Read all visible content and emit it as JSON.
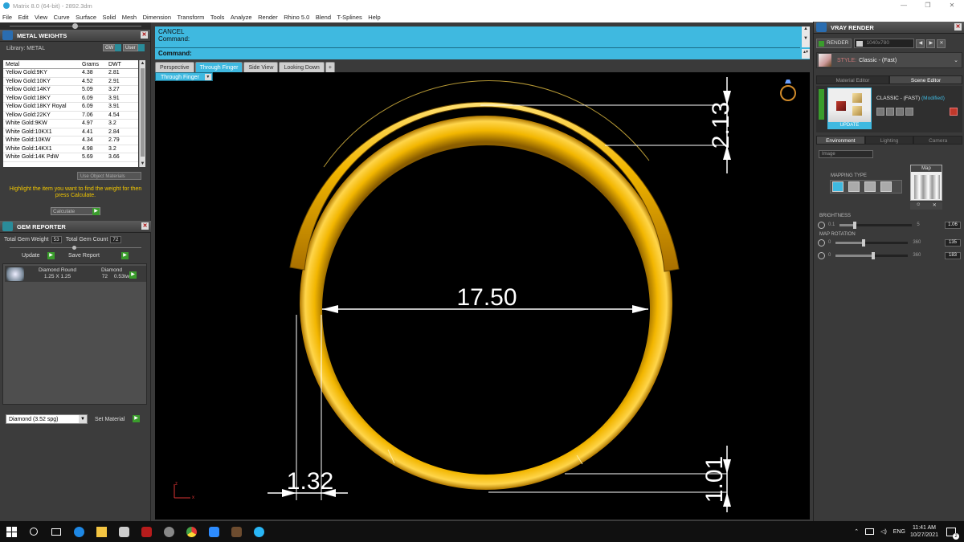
{
  "app": {
    "title": "Matrix 8.0 (64-bit) - 2892.3dm",
    "window_controls": [
      "—",
      "❐",
      "✕"
    ]
  },
  "menu": [
    "File",
    "Edit",
    "View",
    "Curve",
    "Surface",
    "Solid",
    "Mesh",
    "Dimension",
    "Transform",
    "Tools",
    "Analyze",
    "Render",
    "Rhino 5.0",
    "Blend",
    "T-Splines",
    "Help"
  ],
  "metal_weights": {
    "title": "METAL WEIGHTS",
    "library_label": "Library: METAL",
    "gw_label": "GW",
    "user_label": "User",
    "columns": [
      "Metal",
      "Grams",
      "DWT"
    ],
    "rows": [
      [
        "Yellow Gold:9KY",
        "4.38",
        "2.81"
      ],
      [
        "Yellow Gold:10KY",
        "4.52",
        "2.91"
      ],
      [
        "Yellow Gold:14KY",
        "5.09",
        "3.27"
      ],
      [
        "Yellow Gold:18KY",
        "6.09",
        "3.91"
      ],
      [
        "Yellow Gold:18KY Royal",
        "6.09",
        "3.91"
      ],
      [
        "Yellow Gold:22KY",
        "7.06",
        "4.54"
      ],
      [
        "White Gold:9KW",
        "4.97",
        "3.2"
      ],
      [
        "White Gold:10KX1",
        "4.41",
        "2.84"
      ],
      [
        "White Gold:10KW",
        "4.34",
        "2.79"
      ],
      [
        "White Gold:14KX1",
        "4.98",
        "3.2"
      ],
      [
        "White Gold:14K PdW",
        "5.69",
        "3.66"
      ]
    ],
    "use_object_materials": "Use Object Materials",
    "hint": "Highlight the item you want to find the weight for then press Calculate.",
    "calculate_label": "Calculate"
  },
  "gem_reporter": {
    "title": "GEM REPORTER",
    "total_weight_label": "Total Gem Weight",
    "total_weight_value": "53",
    "total_count_label": "Total Gem Count",
    "total_count_value": "72",
    "update_label": "Update",
    "save_report_label": "Save Report",
    "item": {
      "name": "Diamond Round",
      "type": "Diamond",
      "size": "1.25 X 1.25",
      "count": "72",
      "weight": "0.53tw"
    },
    "material_select": "Diamond    (3.52 spg)",
    "set_material_label": "Set Material"
  },
  "command": {
    "line1": "CANCEL",
    "line2": "Command:",
    "prompt": "Command:"
  },
  "viewport_tabs": [
    "Perspective",
    "Through Finger",
    "Side View",
    "Looking Down",
    "+"
  ],
  "active_tab": 1,
  "viewport": {
    "label": "Through Finger",
    "dimensions": {
      "diameter": "17.50",
      "top_height": "2.13",
      "wall_thickness": "1.32",
      "bottom_height": "1.01"
    },
    "colors": {
      "gold": "#f2b600",
      "gold_dark": "#9a6b00",
      "dim_line": "#ffffff"
    }
  },
  "vray": {
    "title": "VRAY RENDER",
    "render_label": "RENDER",
    "resolution": "1040x780",
    "style_label": "STYLE:",
    "style_value": "Classic - (Fast)",
    "tabs": [
      "Material Editor",
      "Scene Editor"
    ],
    "preset_name": "CLASSIC - (FAST)",
    "preset_modified": "(Modified)",
    "update_label": "UPDATE",
    "env_tabs": [
      "Environment",
      "Lighting",
      "Camera"
    ],
    "env_mode": "Image",
    "mapping_type_label": "MAPPING TYPE",
    "map_label": "Map",
    "brightness": {
      "label": "BRIGHTNESS",
      "min": "0.1",
      "max": "5",
      "value": "1.06"
    },
    "map_rotation_label": "MAP ROTATION",
    "rotation1": {
      "min": "0",
      "max": "360",
      "value": "135"
    },
    "rotation2": {
      "min": "0",
      "max": "360",
      "value": "183"
    }
  },
  "taskbar": {
    "lang": "ENG",
    "time": "11:41 AM",
    "date": "10/27/2021",
    "notif_count": "2"
  }
}
